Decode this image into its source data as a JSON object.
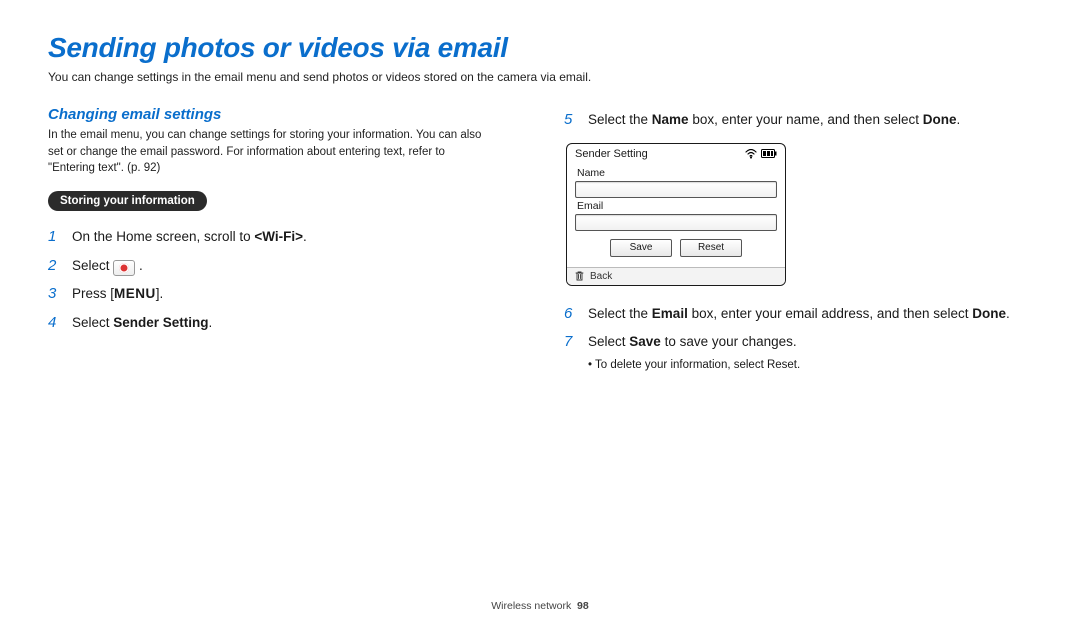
{
  "title": "Sending photos or videos via email",
  "intro": "You can change settings in the email menu and send photos or videos stored on the camera via email.",
  "section": {
    "heading": "Changing email settings",
    "para": "In the email menu, you can change settings for storing your information. You can also set or change the email password. For information about entering text, refer to \"Entering text\". (p. 92)",
    "pill": "Storing your information"
  },
  "steps_left": {
    "s1_pre": "On the Home screen, scroll to ",
    "s1_b": "<Wi-Fi>",
    "s1_post": ".",
    "s2_pre": "Select ",
    "s2_post": " .",
    "s3_pre": "Press [",
    "s3_menu": "MENU",
    "s3_post": "].",
    "s4_pre": "Select ",
    "s4_b": "Sender Setting",
    "s4_post": "."
  },
  "steps_right": {
    "s5_pre": "Select the ",
    "s5_b1": "Name",
    "s5_mid": " box, enter your name, and then select ",
    "s5_b2": "Done",
    "s5_post": ".",
    "s6_pre": "Select the ",
    "s6_b1": "Email",
    "s6_mid": " box, enter your email address, and then select ",
    "s6_b2": "Done",
    "s6_post": ".",
    "s7_pre": "Select ",
    "s7_b": "Save",
    "s7_post": " to save your changes.",
    "s7_sub": "To delete your information, select Reset."
  },
  "nums": {
    "n1": "1",
    "n2": "2",
    "n3": "3",
    "n4": "4",
    "n5": "5",
    "n6": "6",
    "n7": "7"
  },
  "device": {
    "title": "Sender Setting",
    "name_label": "Name",
    "email_label": "Email",
    "save": "Save",
    "reset": "Reset",
    "back": "Back"
  },
  "footer": {
    "section": "Wireless network",
    "page": "98"
  }
}
